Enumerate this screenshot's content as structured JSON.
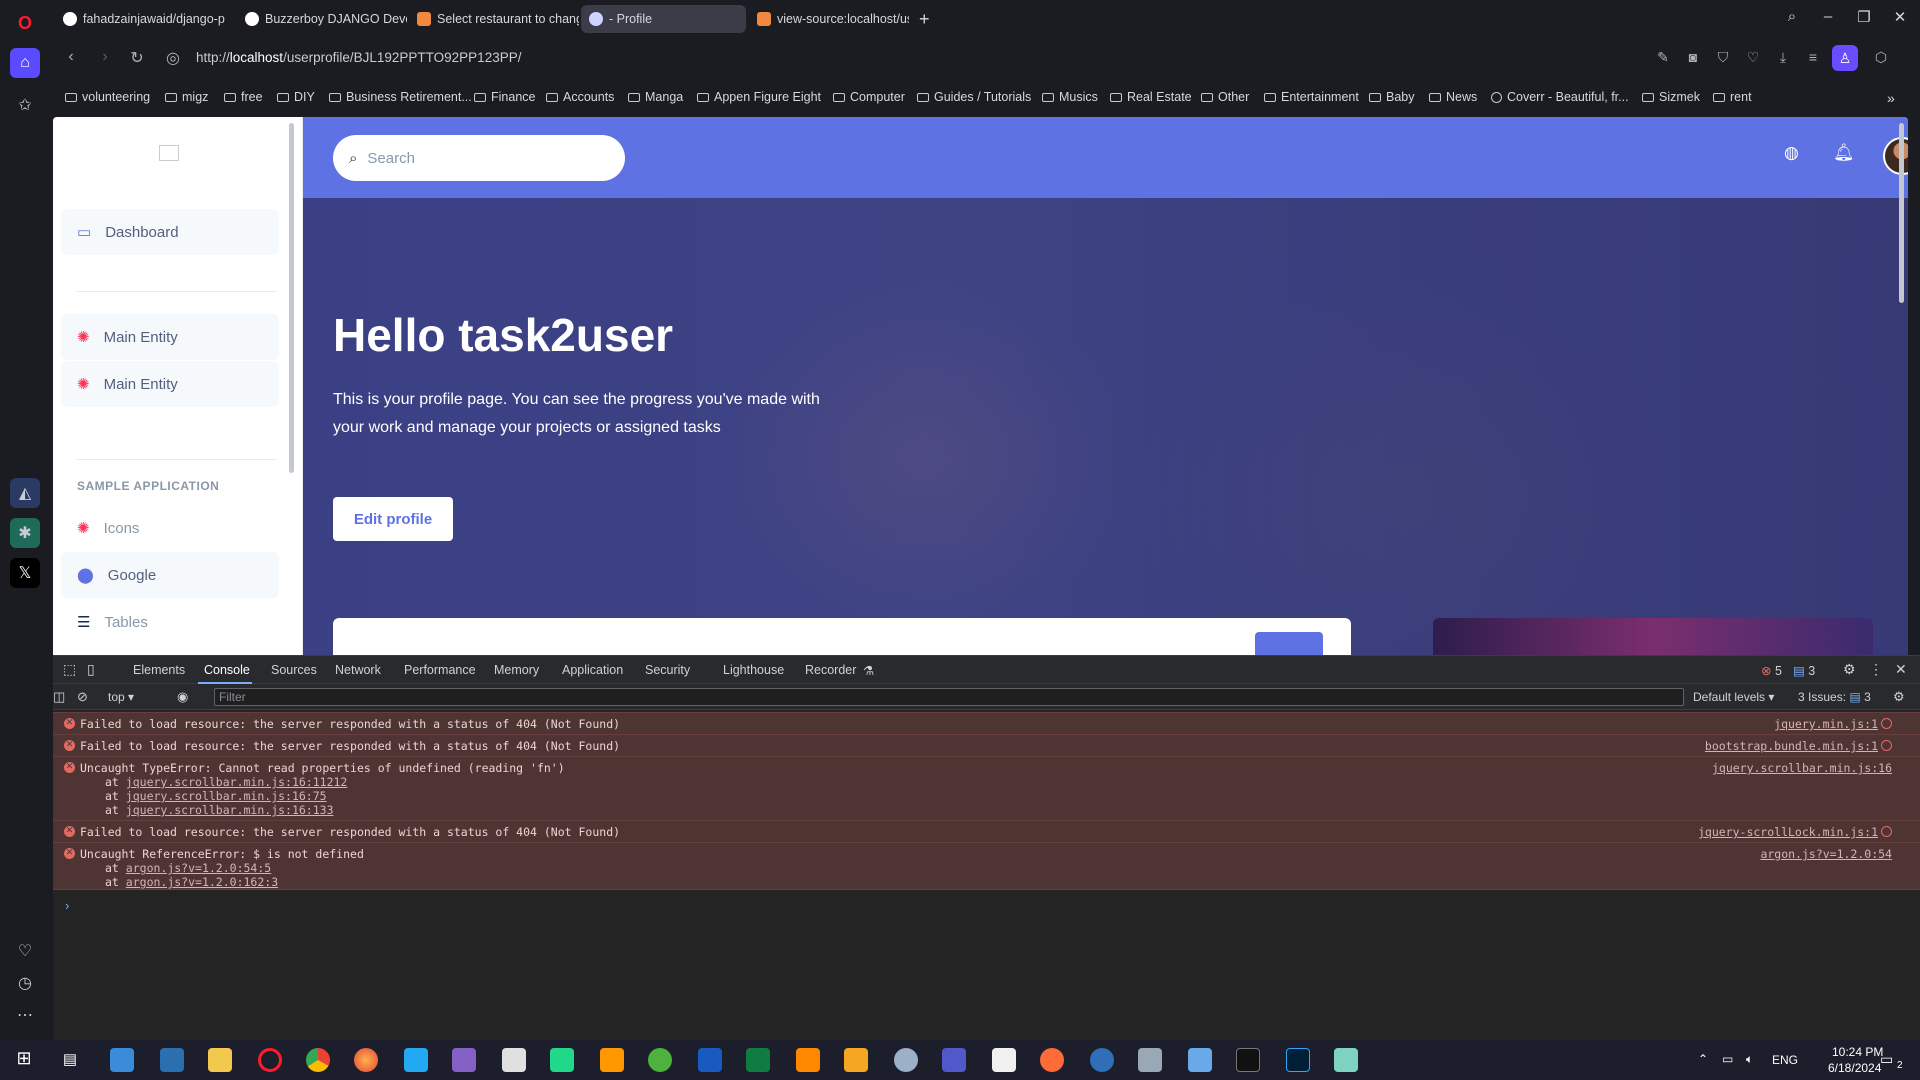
{
  "browser": {
    "tabs": [
      {
        "label": "fahadzainjawaid/django-p",
        "color": "#ffffff"
      },
      {
        "label": "Buzzerboy DJANGO Devel",
        "color": "#ffffff"
      },
      {
        "label": "Select restaurant to chang",
        "color": "#f0883e"
      },
      {
        "label": "- Profile",
        "color": "#cfd3ff"
      },
      {
        "label": "view-source:localhost/use",
        "color": "#f0883e"
      }
    ],
    "url_prefix": "http://",
    "url_host": "localhost",
    "url_path": "/userprofile/BJL192PPTTO92PP123PP/",
    "bookmarks": [
      "volunteering",
      "migz",
      "free",
      "DIY",
      "Business Retirement...",
      "Finance",
      "Accounts",
      "Manga",
      "Appen Figure Eight",
      "Computer",
      "Guides / Tutorials",
      "Musics",
      "Real Estate",
      "Other",
      "Entertainment",
      "Baby",
      "News",
      "Coverr - Beautiful, fr...",
      "Sizmek",
      "rent"
    ]
  },
  "page": {
    "sidebar": {
      "items": [
        {
          "label": "Dashboard",
          "icon": "monitor-icon"
        },
        {
          "label": "Main Entity",
          "icon": "bug-icon"
        },
        {
          "label": "Main Entity",
          "icon": "bug-icon"
        }
      ],
      "heading": "SAMPLE APPLICATION",
      "sample_items": [
        {
          "label": "Icons",
          "icon": "bug-icon"
        },
        {
          "label": "Google",
          "icon": "map-pin-icon"
        },
        {
          "label": "Tables",
          "icon": "list-icon"
        }
      ]
    },
    "search_placeholder": "Search",
    "hero_title": "Hello task2user",
    "hero_text": "This is your profile page. You can see the progress you've made with your work and manage your projects or assigned tasks",
    "edit_profile": "Edit profile",
    "accent": "#5e72e4"
  },
  "devtools": {
    "tabs": [
      "Elements",
      "Console",
      "Sources",
      "Network",
      "Performance",
      "Memory",
      "Application",
      "Security",
      "Lighthouse",
      "Recorder"
    ],
    "error_count": "5",
    "message_count": "3",
    "context": "top",
    "filter_placeholder": "Filter",
    "levels": "Default levels",
    "issues": "3 Issues:",
    "issues_count": "3",
    "messages": [
      {
        "text": "Failed to load resource: the server responded with a status of 404 (Not Found)",
        "source": "jquery.min.js:1"
      },
      {
        "text": "Failed to load resource: the server responded with a status of 404 (Not Found)",
        "source": "bootstrap.bundle.min.js:1"
      },
      {
        "text": "Uncaught TypeError: Cannot read properties of undefined (reading 'fn')",
        "source": "jquery.scrollbar.min.js:16",
        "stack": [
          "jquery.scrollbar.min.js:16:11212",
          "jquery.scrollbar.min.js:16:75",
          "jquery.scrollbar.min.js:16:133"
        ]
      },
      {
        "text": "Failed to load resource: the server responded with a status of 404 (Not Found)",
        "source": "jquery-scrollLock.min.js:1"
      },
      {
        "text": "Uncaught ReferenceError: $ is not defined",
        "source": "argon.js?v=1.2.0:54",
        "stack": [
          "argon.js?v=1.2.0:54:5",
          "argon.js?v=1.2.0:162:3"
        ]
      }
    ],
    "stack_prefix": "at"
  },
  "taskbar": {
    "language": "ENG",
    "time": "10:24 PM",
    "date": "6/18/2024",
    "notifications": "2"
  }
}
